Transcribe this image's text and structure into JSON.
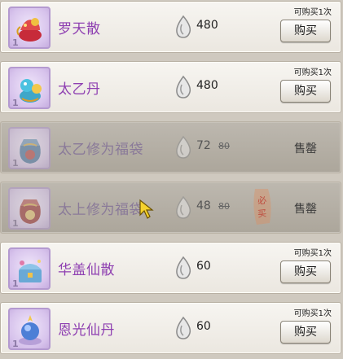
{
  "items": [
    {
      "name": "罗天散",
      "qty": "1",
      "price": "480",
      "limit": "可购买1次",
      "buy_label": "购买",
      "icon": "red-dragon-powder-icon",
      "sold_out": false
    },
    {
      "name": "太乙丹",
      "qty": "1",
      "price": "480",
      "limit": "可购买1次",
      "buy_label": "购买",
      "icon": "blue-gourd-pill-icon",
      "sold_out": false
    },
    {
      "name": "太乙修为福袋",
      "qty": "1",
      "price": "72",
      "old_price": "80",
      "sold_label": "售罄",
      "icon": "blue-lucky-bag-icon",
      "sold_out": true
    },
    {
      "name": "太上修为福袋",
      "qty": "1",
      "price": "48",
      "old_price": "80",
      "sold_label": "售罄",
      "icon": "red-lucky-bag-icon",
      "sold_out": true
    },
    {
      "name": "华盖仙散",
      "qty": "1",
      "price": "60",
      "limit": "可购买1次",
      "buy_label": "购买",
      "icon": "jeweled-chest-icon",
      "sold_out": false
    },
    {
      "name": "恩光仙丹",
      "qty": "1",
      "price": "60",
      "limit": "可购买1次",
      "buy_label": "购买",
      "icon": "blue-orb-pill-icon",
      "sold_out": false
    }
  ],
  "seal_text": "必买",
  "currency_icon": "silver-teardrop-coin-icon",
  "colors": {
    "item_name": "#8e3fb1",
    "slot_border": "#b49ad0",
    "row_bg": "#f2efea",
    "soldout_bg": "#b4afa5"
  }
}
